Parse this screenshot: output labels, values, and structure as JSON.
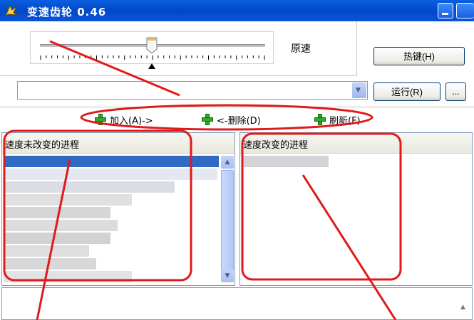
{
  "window": {
    "title": "变速齿轮 0.46",
    "icon": "gear-app-icon"
  },
  "slider": {
    "label": "原速",
    "value_label": "原速"
  },
  "buttons": {
    "hotkey": "热键(H)",
    "run": "运行(R)",
    "more": "..."
  },
  "process_select": {
    "value": "",
    "placeholder": ""
  },
  "toolbar": {
    "add": "加入(A)->",
    "remove": "<-删除(D)",
    "refresh": "刷新(F)"
  },
  "lists": {
    "unchanged_title": "速度未改变的进程",
    "changed_title": "速度改变的进程"
  },
  "colors": {
    "title_bar": "#0a54d8",
    "selection": "#316ac5",
    "annotation": "#e01a1a",
    "add_icon": "#2fa62f"
  }
}
